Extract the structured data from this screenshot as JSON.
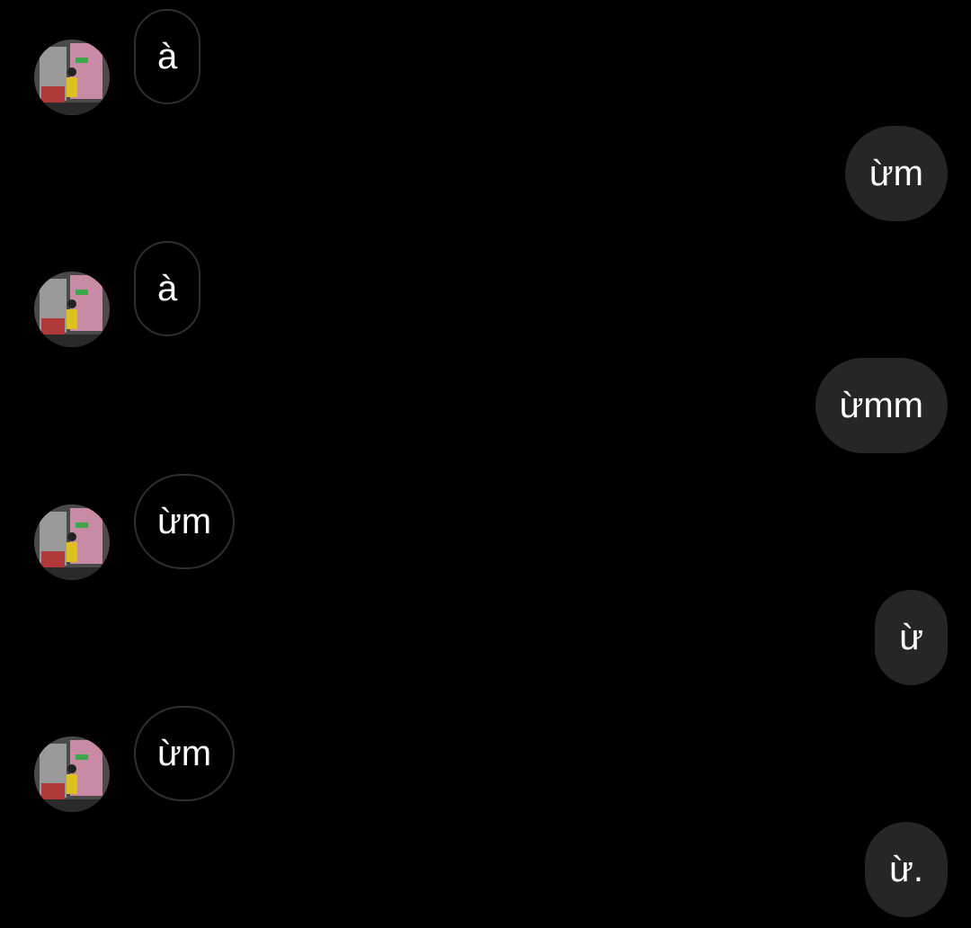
{
  "messages": [
    {
      "direction": "incoming",
      "text": "à",
      "has_avatar": true
    },
    {
      "direction": "outgoing",
      "text": "ừm"
    },
    {
      "direction": "incoming",
      "text": "à",
      "has_avatar": true
    },
    {
      "direction": "outgoing",
      "text": "ừmm"
    },
    {
      "direction": "incoming",
      "text": "ừm",
      "has_avatar": true
    },
    {
      "direction": "outgoing",
      "text": "ừ"
    },
    {
      "direction": "incoming",
      "text": "ừm",
      "has_avatar": true
    },
    {
      "direction": "outgoing",
      "text": "ừ."
    }
  ],
  "colors": {
    "background": "#000000",
    "incoming_bubble_border": "#2f2f2f",
    "outgoing_bubble_fill": "#262626",
    "text": "#ffffff"
  },
  "icons": {
    "avatar": "contact-avatar-photo"
  }
}
